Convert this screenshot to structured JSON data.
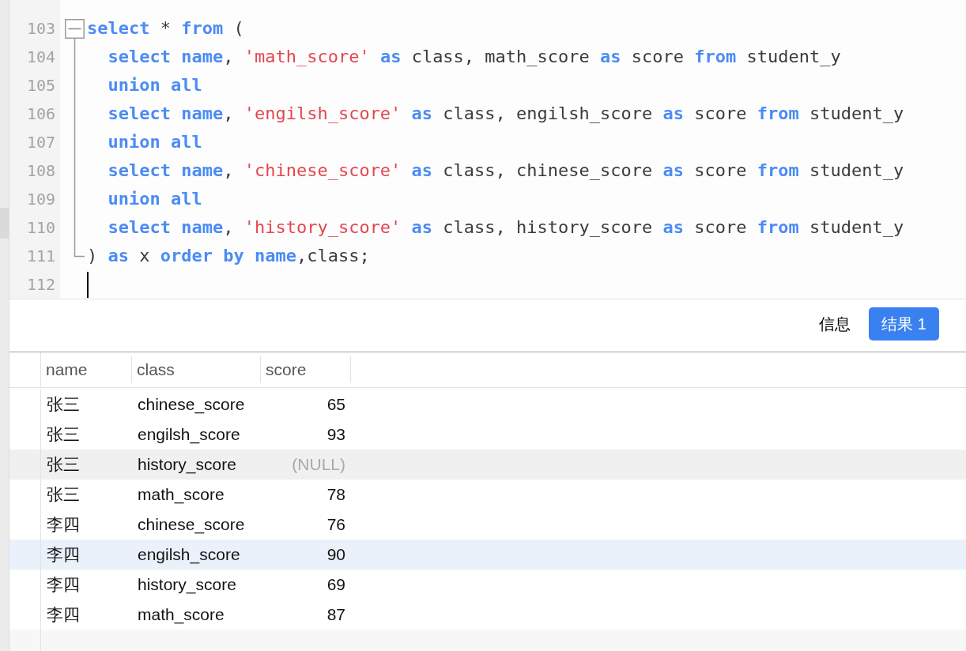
{
  "editor": {
    "fold": {
      "expanded": true
    },
    "lines": [
      {
        "number": "103",
        "indented": false,
        "cursor": false,
        "tokens": [
          {
            "kind": "keyword",
            "text": "select"
          },
          {
            "kind": "plain",
            "text": " * "
          },
          {
            "kind": "keyword",
            "text": "from"
          },
          {
            "kind": "plain",
            "text": " ("
          }
        ]
      },
      {
        "number": "104",
        "indented": true,
        "cursor": false,
        "tokens": [
          {
            "kind": "keyword",
            "text": "select name"
          },
          {
            "kind": "plain",
            "text": ", "
          },
          {
            "kind": "string",
            "text": "'math_score'"
          },
          {
            "kind": "keyword",
            "text": " as"
          },
          {
            "kind": "plain",
            "text": " class, math_score "
          },
          {
            "kind": "keyword",
            "text": "as"
          },
          {
            "kind": "plain",
            "text": " score "
          },
          {
            "kind": "keyword",
            "text": "from"
          },
          {
            "kind": "plain",
            "text": " student_y"
          }
        ]
      },
      {
        "number": "105",
        "indented": true,
        "cursor": false,
        "tokens": [
          {
            "kind": "keyword",
            "text": "union all"
          }
        ]
      },
      {
        "number": "106",
        "indented": true,
        "cursor": false,
        "tokens": [
          {
            "kind": "keyword",
            "text": "select name"
          },
          {
            "kind": "plain",
            "text": ", "
          },
          {
            "kind": "string",
            "text": "'engilsh_score'"
          },
          {
            "kind": "keyword",
            "text": " as"
          },
          {
            "kind": "plain",
            "text": " class, engilsh_score "
          },
          {
            "kind": "keyword",
            "text": "as"
          },
          {
            "kind": "plain",
            "text": " score "
          },
          {
            "kind": "keyword",
            "text": "from"
          },
          {
            "kind": "plain",
            "text": " student_y"
          }
        ]
      },
      {
        "number": "107",
        "indented": true,
        "cursor": false,
        "tokens": [
          {
            "kind": "keyword",
            "text": "union all"
          }
        ]
      },
      {
        "number": "108",
        "indented": true,
        "cursor": false,
        "tokens": [
          {
            "kind": "keyword",
            "text": "select name"
          },
          {
            "kind": "plain",
            "text": ", "
          },
          {
            "kind": "string",
            "text": "'chinese_score'"
          },
          {
            "kind": "keyword",
            "text": " as"
          },
          {
            "kind": "plain",
            "text": " class, chinese_score "
          },
          {
            "kind": "keyword",
            "text": "as"
          },
          {
            "kind": "plain",
            "text": " score "
          },
          {
            "kind": "keyword",
            "text": "from"
          },
          {
            "kind": "plain",
            "text": " student_y"
          }
        ]
      },
      {
        "number": "109",
        "indented": true,
        "cursor": false,
        "tokens": [
          {
            "kind": "keyword",
            "text": "union all"
          }
        ]
      },
      {
        "number": "110",
        "indented": true,
        "cursor": false,
        "tokens": [
          {
            "kind": "keyword",
            "text": "select name"
          },
          {
            "kind": "plain",
            "text": ", "
          },
          {
            "kind": "string",
            "text": "'history_score'"
          },
          {
            "kind": "keyword",
            "text": " as"
          },
          {
            "kind": "plain",
            "text": " class, history_score "
          },
          {
            "kind": "keyword",
            "text": "as"
          },
          {
            "kind": "plain",
            "text": " score "
          },
          {
            "kind": "keyword",
            "text": "from"
          },
          {
            "kind": "plain",
            "text": " student_y"
          }
        ]
      },
      {
        "number": "111",
        "indented": false,
        "cursor": false,
        "tokens": [
          {
            "kind": "plain",
            "text": ") "
          },
          {
            "kind": "keyword",
            "text": "as"
          },
          {
            "kind": "plain",
            "text": " x "
          },
          {
            "kind": "keyword",
            "text": "order by name"
          },
          {
            "kind": "plain",
            "text": ",class;"
          }
        ]
      },
      {
        "number": "112",
        "indented": false,
        "cursor": true
      }
    ]
  },
  "result_tabs": [
    {
      "label": "信息",
      "selected": false
    },
    {
      "label": "结果 1",
      "selected": true
    }
  ],
  "table": {
    "columns": [
      {
        "label": "name",
        "kind": "text"
      },
      {
        "label": "class",
        "kind": "text"
      },
      {
        "label": "score",
        "kind": "number"
      }
    ],
    "rows": [
      {
        "cells": [
          "张三",
          "chinese_score",
          "65"
        ],
        "score_is_null": false,
        "shaded": false,
        "selected": false
      },
      {
        "cells": [
          "张三",
          "engilsh_score",
          "93"
        ],
        "score_is_null": false,
        "shaded": false,
        "selected": false
      },
      {
        "cells": [
          "张三",
          "history_score",
          "(NULL)"
        ],
        "score_is_null": true,
        "shaded": true,
        "selected": false
      },
      {
        "cells": [
          "张三",
          "math_score",
          "78"
        ],
        "score_is_null": false,
        "shaded": false,
        "selected": false
      },
      {
        "cells": [
          "李四",
          "chinese_score",
          "76"
        ],
        "score_is_null": false,
        "shaded": false,
        "selected": false
      },
      {
        "cells": [
          "李四",
          "engilsh_score",
          "90"
        ],
        "score_is_null": false,
        "shaded": false,
        "selected": true
      },
      {
        "cells": [
          "李四",
          "history_score",
          "69"
        ],
        "score_is_null": false,
        "shaded": false,
        "selected": false
      },
      {
        "cells": [
          "李四",
          "math_score",
          "87"
        ],
        "score_is_null": false,
        "shaded": false,
        "selected": false
      }
    ]
  }
}
